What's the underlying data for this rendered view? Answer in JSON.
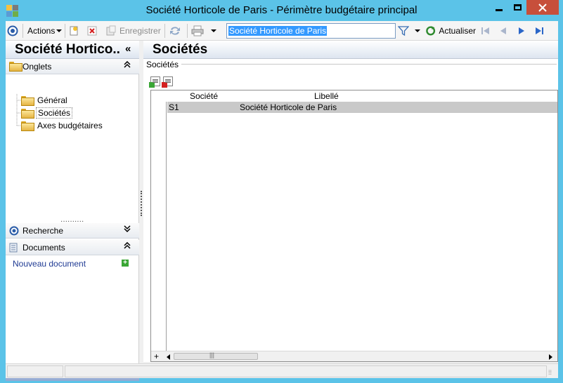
{
  "window": {
    "title": "Société Horticole de Paris -  Périmètre budgétaire principal",
    "controls": [
      "minimize",
      "maximize",
      "close"
    ]
  },
  "toolbar": {
    "actions_label": "Actions",
    "save_label": "Enregistrer",
    "search_value": "Société Horticole de Paris",
    "refresh_label": "Actualiser"
  },
  "left_panel": {
    "title": "Société Hortico..",
    "collapse_glyph": "«",
    "onglets": {
      "label": "Onglets",
      "chevron": "⌃",
      "items": [
        {
          "label": "Général",
          "selected": false
        },
        {
          "label": "Sociétés",
          "selected": true
        },
        {
          "label": "Axes budgétaires",
          "selected": false
        }
      ]
    },
    "gripper": "··········",
    "recherche": {
      "label": "Recherche",
      "chevron": "⌄"
    },
    "documents": {
      "label": "Documents",
      "chevron": "⌃",
      "new_link": "Nouveau document"
    },
    "bottom_chevron": "⌄"
  },
  "main": {
    "title": "Sociétés",
    "group_label": "Sociétés",
    "grid": {
      "columns": [
        "Société",
        "Libellé"
      ],
      "rows": [
        {
          "code": "S1",
          "label": "Société Horticole de Paris"
        }
      ],
      "add_glyph": "+"
    }
  },
  "colors": {
    "window_frame": "#5bc3e8",
    "close_button": "#c74f3b",
    "selection_blue": "#3399ff",
    "row_selected": "#c9c9c9"
  }
}
